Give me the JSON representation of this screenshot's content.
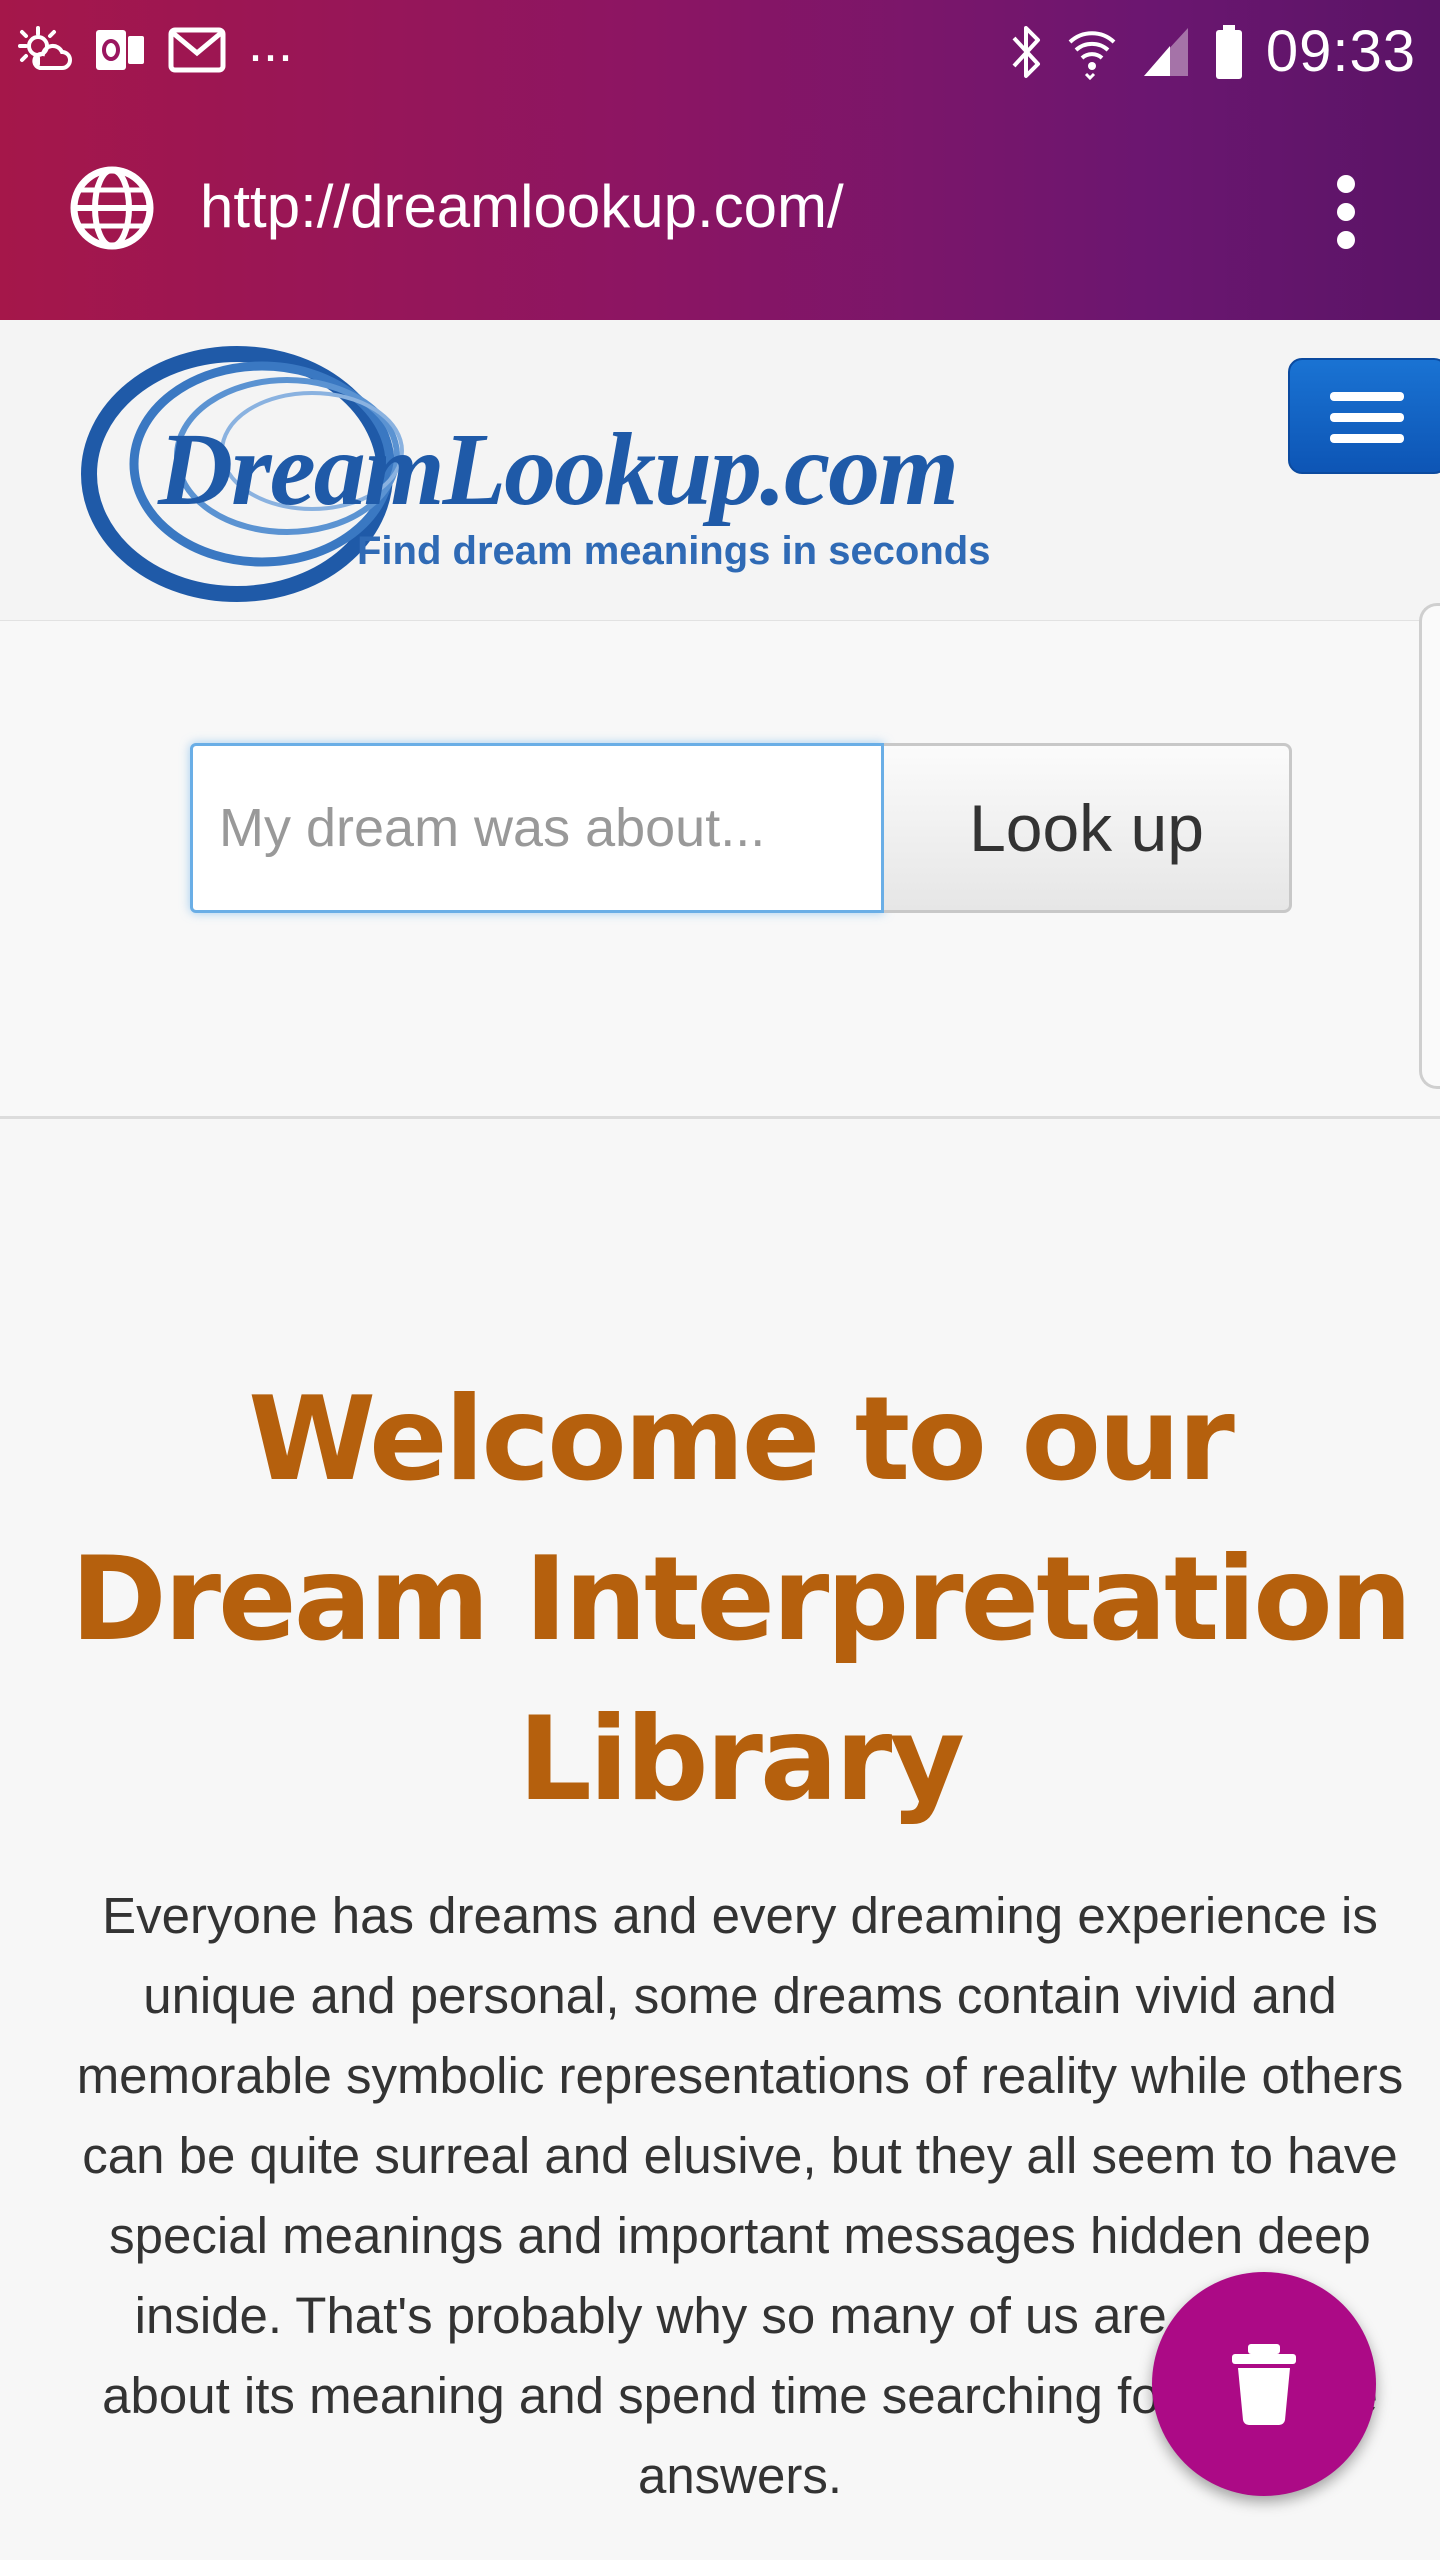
{
  "status_bar": {
    "time": "09:33",
    "more_indicator": "...",
    "left_icons": [
      "weather-icon",
      "outlook-icon",
      "gmail-icon"
    ],
    "right_icons": [
      "bluetooth-icon",
      "wifi-icon",
      "signal-icon",
      "battery-icon"
    ]
  },
  "browser": {
    "url": "http://dreamlookup.com/",
    "site_icon": "globe-icon",
    "menu_icon": "kebab-menu-icon",
    "theme_colors": [
      "#a5174a",
      "#5a1466"
    ]
  },
  "site": {
    "logo": {
      "name": "DreamLookup.com",
      "tagline": "Find dream meanings in seconds"
    },
    "menu_icon": "hamburger-menu-icon",
    "search": {
      "placeholder": "My dream was about...",
      "value": "",
      "button_label": "Look up"
    },
    "welcome": {
      "title": "Welcome to our Dream Interpretation Library",
      "body": "Everyone has dreams and every dreaming experience is unique and personal, some dreams contain vivid and memorable symbolic representations of reality while others can be quite surreal and elusive, but they all seem to have special meanings and important messages hidden deep inside. That's probably why so many of us are curious about its meaning and spend time searching for possible answers."
    }
  },
  "fab": {
    "icon": "trash-icon",
    "color": "#ac0a86"
  },
  "colors": {
    "heading": "#b5600d",
    "menu_button": "#1a73d3",
    "logo_blue": "#1f5aa8"
  }
}
